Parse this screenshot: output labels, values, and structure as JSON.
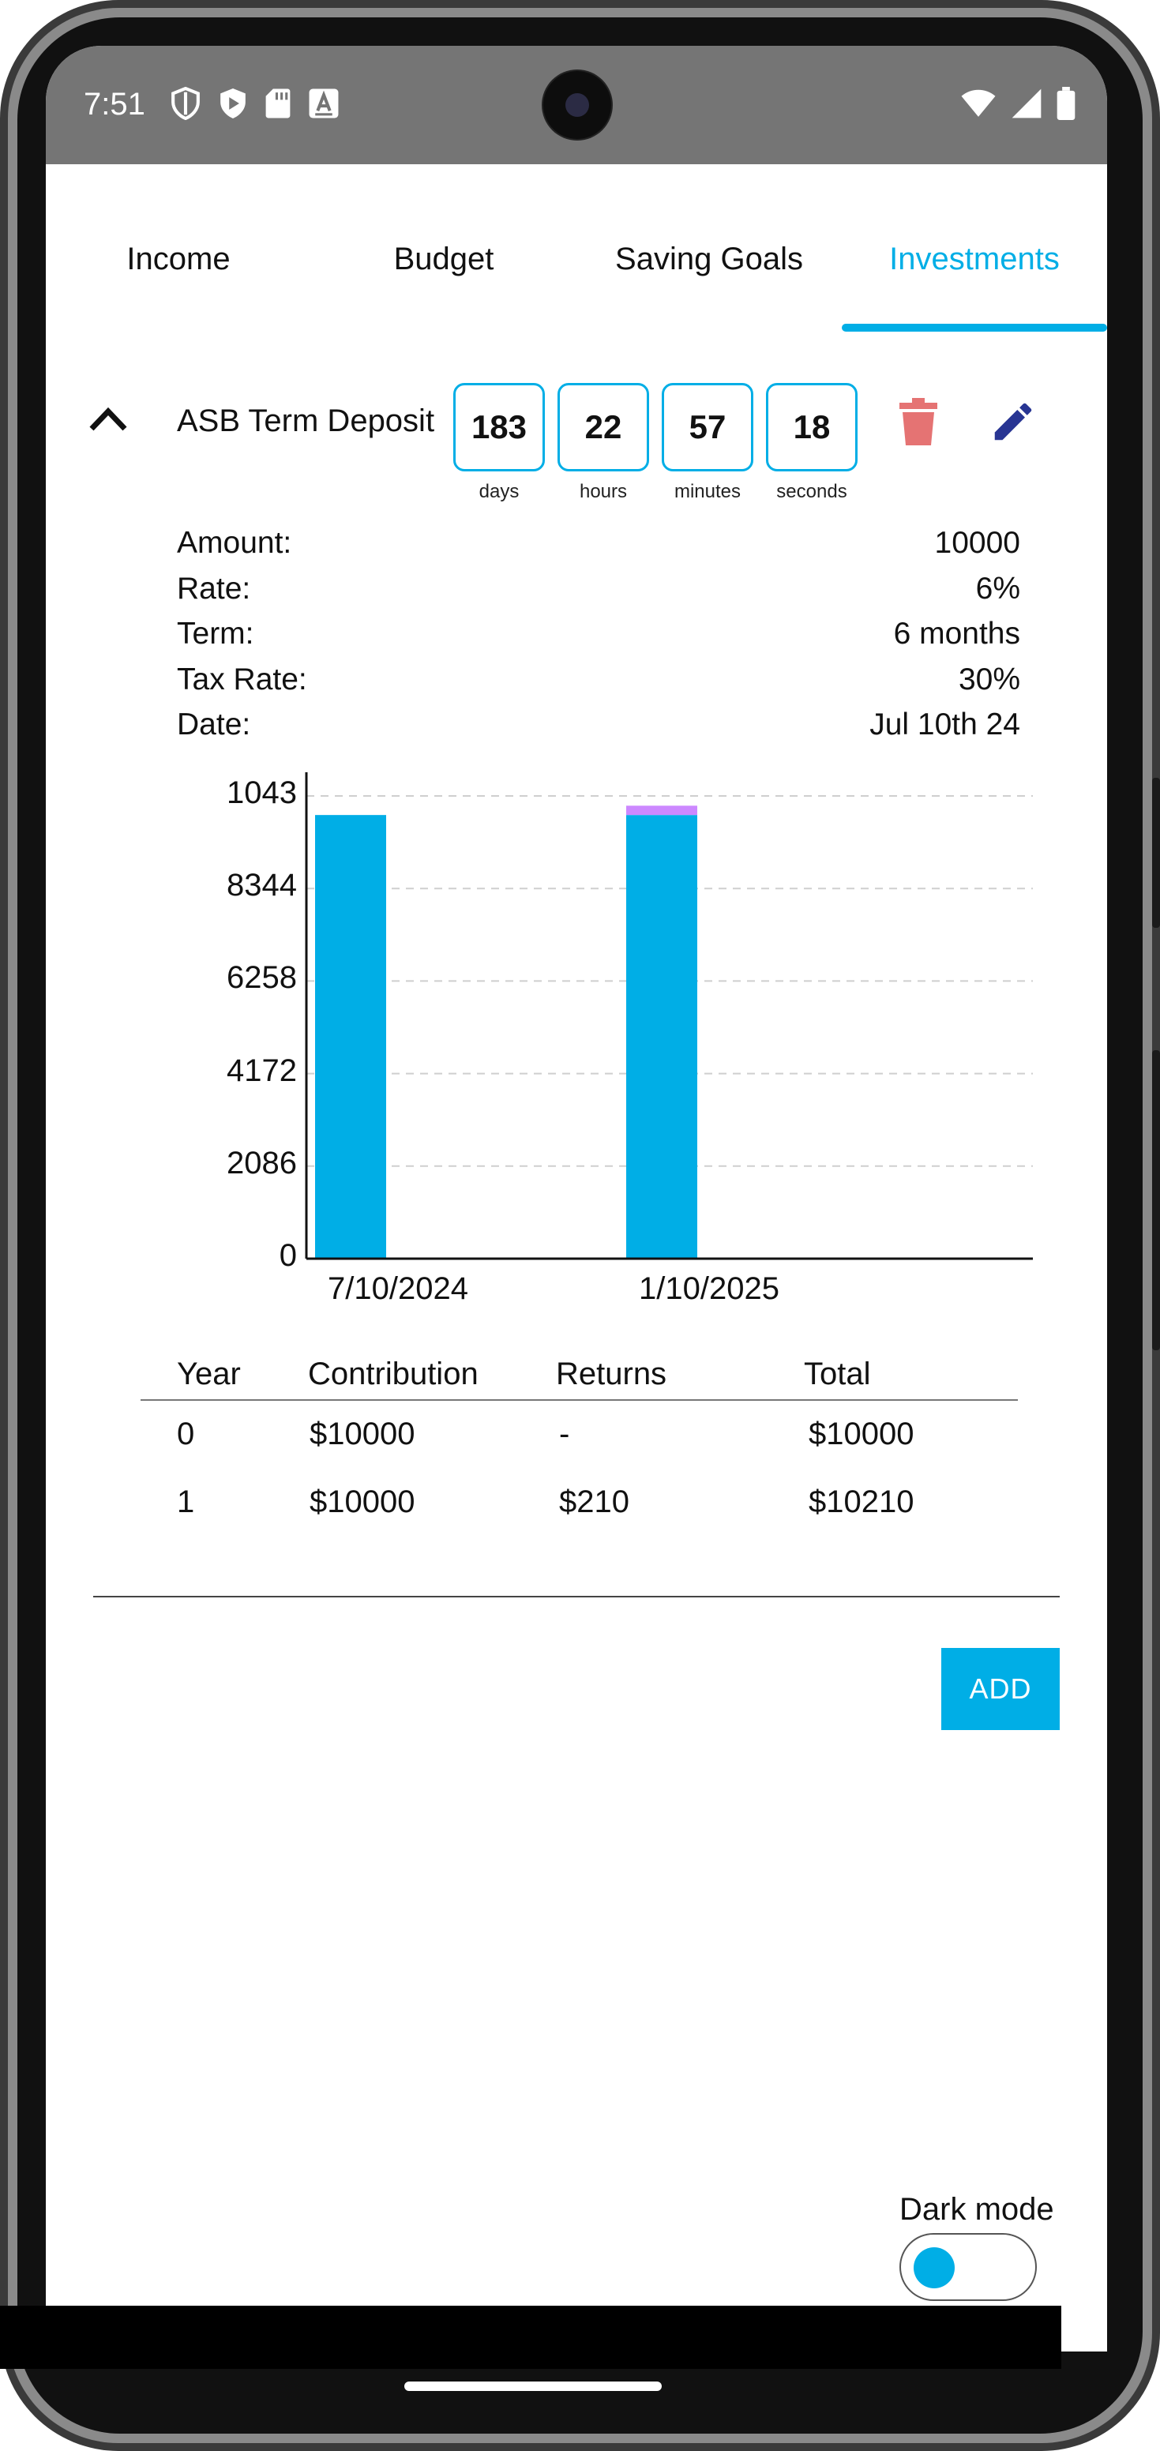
{
  "status_bar": {
    "time": "7:51",
    "icons_left": [
      "shield-outline-icon",
      "play-shield-icon",
      "sd-card-icon",
      "font-a-icon"
    ],
    "icons_right": [
      "wifi-icon",
      "signal-icon",
      "battery-icon"
    ]
  },
  "tabs": [
    {
      "label": "Income",
      "active": false
    },
    {
      "label": "Budget",
      "active": false
    },
    {
      "label": "Saving Goals",
      "active": false
    },
    {
      "label": "Investments",
      "active": true
    }
  ],
  "accent_color": "#00AEE6",
  "investment": {
    "title": "ASB Term Deposit",
    "countdown": [
      {
        "value": "183",
        "unit": "days"
      },
      {
        "value": "22",
        "unit": "hours"
      },
      {
        "value": "57",
        "unit": "minutes"
      },
      {
        "value": "18",
        "unit": "seconds"
      }
    ],
    "details": [
      {
        "label": "Amount:",
        "value": "10000"
      },
      {
        "label": "Rate:",
        "value": "6%"
      },
      {
        "label": "Term:",
        "value": "6 months"
      },
      {
        "label": "Tax Rate:",
        "value": "30%"
      },
      {
        "label": "Date:",
        "value": "Jul 10th 24"
      }
    ],
    "delete_icon_color": "#E57373",
    "edit_icon_color": "#283593"
  },
  "chart_data": {
    "type": "bar",
    "stacked": true,
    "categories": [
      "7/10/2024",
      "1/10/2025"
    ],
    "series": [
      {
        "values": [
          10000,
          10000
        ],
        "color": "#00AEE6"
      },
      {
        "values": [
          0,
          210
        ],
        "color": "#CC88FF"
      }
    ],
    "yticks": [
      "0",
      "2086",
      "4172",
      "6258",
      "8344",
      "1043"
    ],
    "ylim": [
      0,
      10430
    ],
    "grid": true
  },
  "table": {
    "headers": [
      "Year",
      "Contribution",
      "Returns",
      "Total"
    ],
    "rows": [
      [
        "0",
        "$10000",
        "-",
        "$10000"
      ],
      [
        "1",
        "$10000",
        "$210",
        "$10210"
      ]
    ]
  },
  "add_button": {
    "label": "ADD"
  },
  "dark_mode": {
    "label": "Dark mode",
    "on": false
  }
}
